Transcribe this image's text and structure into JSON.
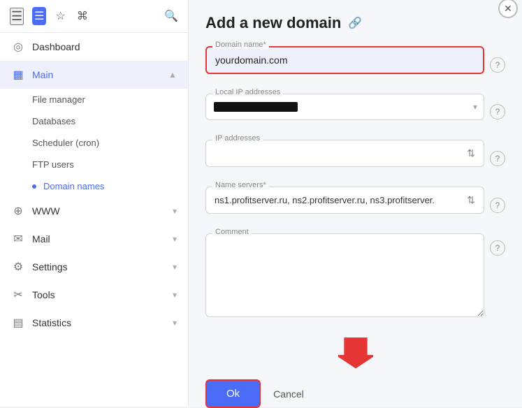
{
  "sidebar": {
    "nav_items": [
      {
        "id": "dashboard",
        "label": "Dashboard",
        "icon": "⊙",
        "type": "item"
      },
      {
        "id": "main",
        "label": "Main",
        "icon": "▦",
        "type": "expandable",
        "expanded": true
      },
      {
        "id": "file-manager",
        "label": "File manager",
        "type": "sub"
      },
      {
        "id": "databases",
        "label": "Databases",
        "type": "sub"
      },
      {
        "id": "scheduler",
        "label": "Scheduler (cron)",
        "type": "sub"
      },
      {
        "id": "ftp-users",
        "label": "FTP users",
        "type": "sub"
      },
      {
        "id": "domain-names",
        "label": "Domain names",
        "type": "sub",
        "active": true
      },
      {
        "id": "www",
        "label": "WWW",
        "icon": "⊕",
        "type": "expandable"
      },
      {
        "id": "mail",
        "label": "Mail",
        "icon": "✉",
        "type": "expandable"
      },
      {
        "id": "settings",
        "label": "Settings",
        "icon": "⚙",
        "type": "expandable"
      },
      {
        "id": "tools",
        "label": "Tools",
        "icon": "✂",
        "type": "expandable"
      },
      {
        "id": "statistics",
        "label": "Statistics",
        "icon": "📊",
        "type": "expandable"
      }
    ]
  },
  "page": {
    "title": "Add a new domain",
    "link_tooltip": "link"
  },
  "form": {
    "domain_name_label": "Domain name*",
    "domain_name_placeholder": "yourdomain.com",
    "domain_name_value": "yourdomain.com",
    "local_ip_label": "Local IP addresses",
    "ip_addresses_label": "IP addresses",
    "name_servers_label": "Name servers*",
    "name_servers_value": "ns1.profitserver.ru, ns2.profitserver.ru, ns3.profitserver.",
    "comment_label": "Comment",
    "ok_label": "Ok",
    "cancel_label": "Cancel"
  },
  "help": {
    "icon": "?"
  }
}
